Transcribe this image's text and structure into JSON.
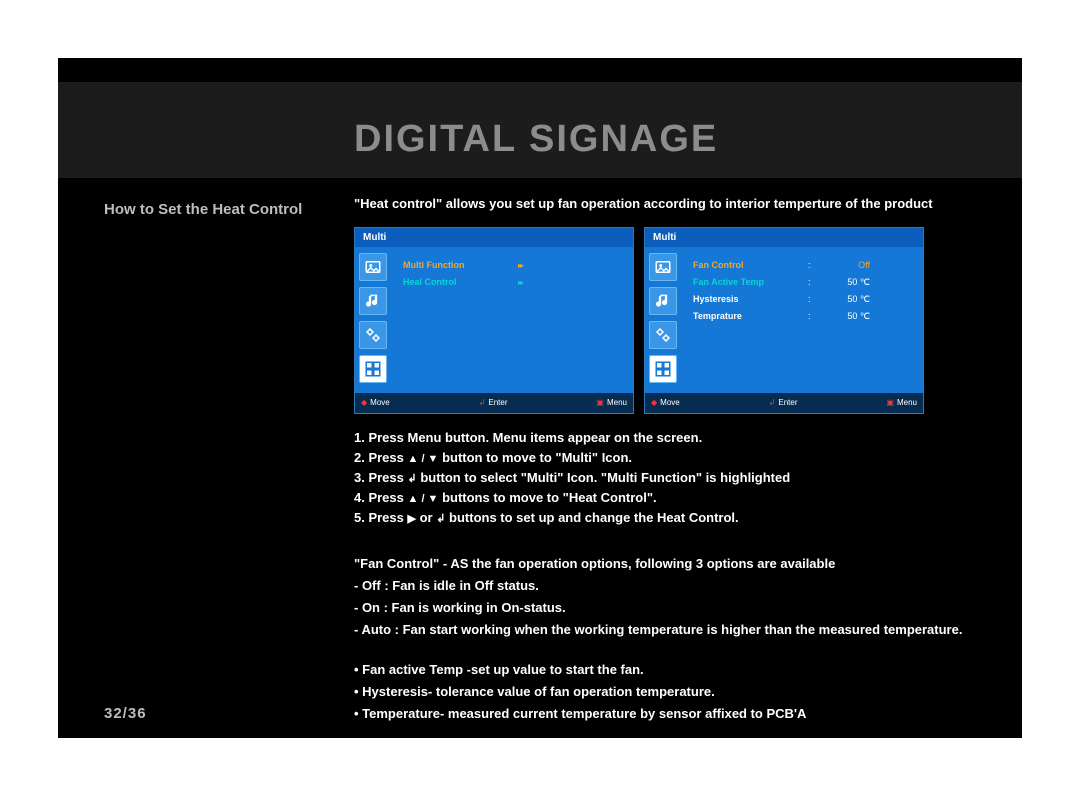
{
  "header": {
    "title": "DIGITAL SIGNAGE"
  },
  "sidebar": {
    "title": "How to Set the Heat Control"
  },
  "pagination": {
    "text": "32/36"
  },
  "intro": "\"Heat control\" allows you set up fan operation according to interior temperture of the product",
  "screenA": {
    "title": "Multi",
    "rows": [
      {
        "label": "Multi Function",
        "cls": "orange",
        "arrow": "▸▸"
      },
      {
        "label": "Heal Control",
        "cls": "teal",
        "arrow": "▸▸"
      }
    ]
  },
  "screenB": {
    "title": "Multi",
    "rows": [
      {
        "label": "Fan Control",
        "cls": "orange",
        "sep": ":",
        "val": "Off",
        "valcls": "orange"
      },
      {
        "label": "Fan Active Temp",
        "cls": "teal",
        "sep": ":",
        "val": "50 ℃",
        "valcls": ""
      },
      {
        "label": "Hysteresis",
        "cls": "white",
        "sep": ":",
        "val": "50 ℃",
        "valcls": ""
      },
      {
        "label": "Temprature",
        "cls": "white",
        "sep": ":",
        "val": "50 ℃",
        "valcls": ""
      }
    ]
  },
  "footer": {
    "move": "Move",
    "enter": "Enter",
    "menu": "Menu"
  },
  "steps": {
    "s1": "1. Press Menu button.  Menu items appear on the screen.",
    "s2a": "2. Press ",
    "s2sym": "▲ / ▼",
    "s2b": " button to move to \"Multi\" Icon.",
    "s3a": "3. Press ",
    "s3sym": "↲",
    "s3b": " button to select \"Multi\" Icon. \"Multi Function\" is highlighted",
    "s4a": "4. Press ",
    "s4sym": "▲ / ▼",
    "s4b": " buttons to move to \"Heat Control\".",
    "s5a": "5. Press ",
    "s5sym1": "▶",
    "s5mid": " or ",
    "s5sym2": "↲",
    "s5b": " buttons to set up and change the Heat Control."
  },
  "fan": {
    "head": "\"Fan Control\" - AS the fan operation options, following 3 options are available",
    "off": " - Off : Fan is idle in Off status.",
    "on": " - On : Fan is working in On-status.",
    "auto": " - Auto : Fan start working when the working temperature is higher than the measured temperature."
  },
  "bullets": {
    "b1": "• Fan active Temp -set up value to start the fan.",
    "b2": "• Hysteresis- tolerance value of fan operation temperature.",
    "b3": "• Temperature- measured current temperature by sensor affixed to PCB'A"
  }
}
